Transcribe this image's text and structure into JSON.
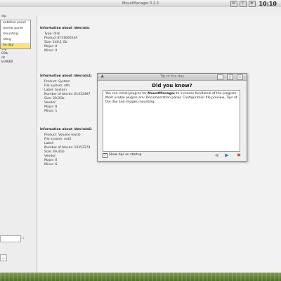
{
  "window": {
    "title": "MountManager  0.2.3"
  },
  "system": {
    "clock": "10:10",
    "tray_icons": [
      "mail-icon",
      "speaker-icon",
      "settings-icon"
    ]
  },
  "menu": {
    "label": "elp",
    "items": [
      {
        "label": "entation panel"
      },
      {
        "label": "review panel"
      },
      {
        "label": "mounting"
      },
      {
        "label": "nting"
      },
      {
        "label": "he day",
        "active": true
      }
    ]
  },
  "devices": [
    "ssp",
    "Disk",
    "ds",
    "ks9660"
  ],
  "info": {
    "sda": {
      "title": "Information about /dev/sda:",
      "lines": [
        "Type: disk",
        "Product:ST3160023A",
        "Size: 149,1 Gb",
        "Major: 8",
        "Minor: 0"
      ]
    },
    "sda1": {
      "title": "Information about /dev/sda1:",
      "lines": [
        "Product: System",
        "File system: ntfs",
        "Label: System",
        "Number of blocks: 61432497",
        "Size: 29,3Gb",
        "Vendor:",
        "Major: 8",
        "Minor: 1"
      ]
    },
    "sda5": {
      "title": "Information about /dev/sda5:"
    },
    "sda6": {
      "title": "Information about /dev/sda6:",
      "lines": [
        "Product: Volume (ext3)",
        "File system: ext3",
        "Label:",
        "Number of blocks: 10352279",
        "Size: 49,4Gb",
        "Vendor:",
        "Major: 8",
        "Minor: 6"
      ]
    }
  },
  "tip_dialog": {
    "title": "Tip of the day",
    "heading": "Did you know?",
    "text_before": "You can install plugins for ",
    "text_bold": "MountManager",
    "text_after": " to increase functional of the program. Most usable plugins are: Documentation panel, Configuration file preview, Tips of the day and Images mounting.",
    "show_tips_label": "Show tips on startup",
    "show_tips_checked": true,
    "check_mark": "✓",
    "prev_glyph": "◀",
    "next_glyph": "▶",
    "close_glyph": "✖",
    "colors": {
      "prev": "#9aa9b8",
      "next": "#3b78c6",
      "close": "#d63a2a"
    }
  },
  "left_panel": {
    "button_glyph": "◁",
    "small_glyph": "…"
  }
}
